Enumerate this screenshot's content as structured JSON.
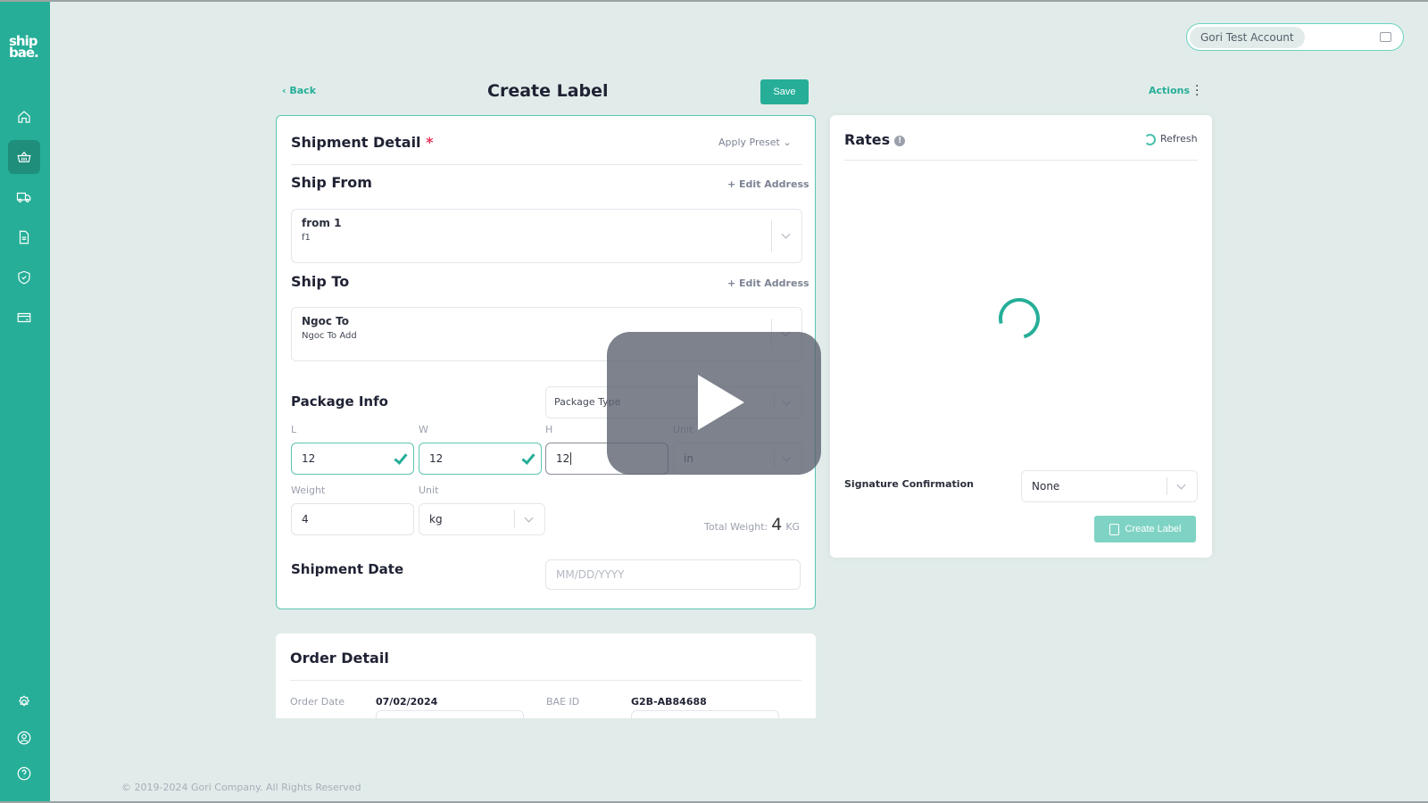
{
  "brand": {
    "logo_line1": "ship",
    "logo_line2": "bae."
  },
  "sidebar": {
    "items": [
      {
        "name": "home",
        "icon": "home-icon",
        "active": false
      },
      {
        "name": "orders",
        "icon": "basket-icon",
        "active": true
      },
      {
        "name": "shipments",
        "icon": "truck-icon",
        "active": false
      },
      {
        "name": "documents",
        "icon": "document-icon",
        "active": false
      },
      {
        "name": "insurance",
        "icon": "shield-check-icon",
        "active": false
      },
      {
        "name": "billing",
        "icon": "credit-card-icon",
        "active": false
      }
    ],
    "bottom_items": [
      {
        "name": "settings",
        "icon": "gear-icon"
      },
      {
        "name": "profile",
        "icon": "user-circle-icon"
      },
      {
        "name": "help",
        "icon": "help-icon"
      }
    ]
  },
  "account": {
    "name": "Gori Test Account",
    "icon": "wallet-icon"
  },
  "header": {
    "back_label": "Back",
    "title": "Create Label",
    "save_label": "Save",
    "actions_label": "Actions"
  },
  "shipment_detail": {
    "title": "Shipment Detail",
    "required_mark": "*",
    "apply_preset": "Apply Preset",
    "ship_from": {
      "title": "Ship From",
      "edit_label": "+ Edit Address",
      "name": "from 1",
      "address": "f1"
    },
    "ship_to": {
      "title": "Ship To",
      "edit_label": "+ Edit Address",
      "name": "Ngoc To",
      "address": "Ngoc To Add"
    },
    "package": {
      "title": "Package Info",
      "package_type_placeholder": "Package Type",
      "l_label": "L",
      "l_value": "12",
      "w_label": "W",
      "w_value": "12",
      "h_label": "H",
      "h_value": "12",
      "dim_unit_label": "Unit",
      "dim_unit": "in",
      "weight_label": "Weight",
      "weight_value": "4",
      "weight_unit_label": "Unit",
      "weight_unit": "kg",
      "total_weight_label": "Total Weight:",
      "total_weight_value": "4",
      "total_weight_unit": "KG"
    },
    "shipment_date": {
      "title": "Shipment Date",
      "placeholder": "MM/DD/YYYY"
    }
  },
  "rates": {
    "title": "Rates",
    "info_glyph": "!",
    "refresh_label": "Refresh",
    "loading": true,
    "signature_label": "Signature Confirmation",
    "signature_value": "None",
    "create_label_button": "Create Label"
  },
  "order_detail": {
    "title": "Order Detail",
    "order_date_label": "Order Date",
    "order_date": "07/02/2024",
    "bae_id_label": "BAE ID",
    "bae_id": "G2B-AB84688"
  },
  "footer": {
    "copyright": "© 2019-2024 Gori Company. All Rights Reserved"
  },
  "video_overlay": {
    "icon": "play-icon"
  },
  "colors": {
    "primary": "#26ae98",
    "background": "#e1ecea",
    "required": "#e8335a"
  }
}
